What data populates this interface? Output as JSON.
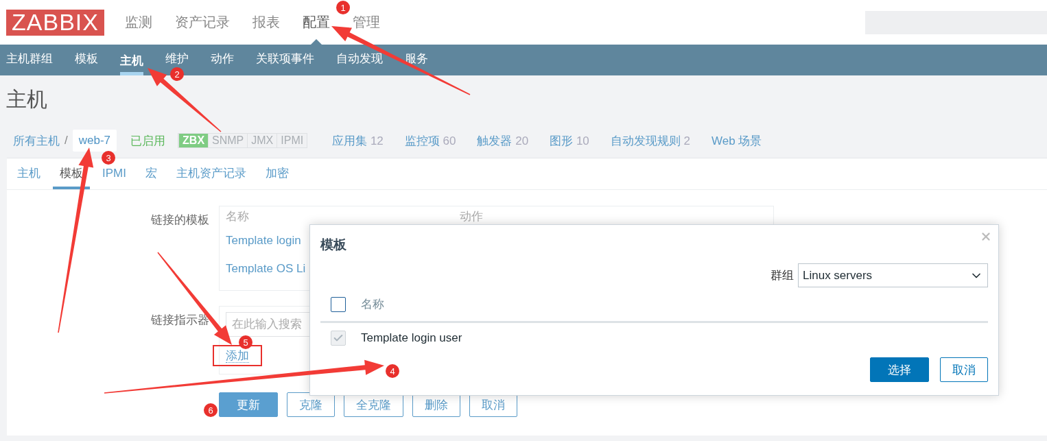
{
  "header": {
    "logo": "ZABBIX",
    "menu": [
      {
        "label": "监测",
        "selected": false
      },
      {
        "label": "资产记录",
        "selected": false
      },
      {
        "label": "报表",
        "selected": false
      },
      {
        "label": "配置",
        "selected": true
      },
      {
        "label": "管理",
        "selected": false
      }
    ]
  },
  "subnav": [
    {
      "label": "主机群组",
      "selected": false
    },
    {
      "label": "模板",
      "selected": false
    },
    {
      "label": "主机",
      "selected": true
    },
    {
      "label": "维护",
      "selected": false
    },
    {
      "label": "动作",
      "selected": false
    },
    {
      "label": "关联项事件",
      "selected": false
    },
    {
      "label": "自动发现",
      "selected": false
    },
    {
      "label": "服务",
      "selected": false
    }
  ],
  "page_title": "主机",
  "breadcrumb": {
    "root": "所有主机",
    "separator": "/",
    "current": "web-7"
  },
  "status": "已启用",
  "availability": [
    {
      "label": "ZBX",
      "on": true
    },
    {
      "label": "SNMP",
      "on": false
    },
    {
      "label": "JMX",
      "on": false
    },
    {
      "label": "IPMI",
      "on": false
    }
  ],
  "host_links": [
    {
      "label": "应用集",
      "count": "12"
    },
    {
      "label": "监控项",
      "count": "60"
    },
    {
      "label": "触发器",
      "count": "20"
    },
    {
      "label": "图形",
      "count": "10"
    },
    {
      "label": "自动发现规则",
      "count": "2"
    },
    {
      "label": "Web 场景"
    }
  ],
  "tabs": [
    {
      "label": "主机",
      "selected": false
    },
    {
      "label": "模板",
      "selected": true
    },
    {
      "label": "IPMI",
      "selected": false
    },
    {
      "label": "宏",
      "selected": false
    },
    {
      "label": "主机资产记录",
      "selected": false
    },
    {
      "label": "加密",
      "selected": false
    }
  ],
  "form": {
    "linked_templates": {
      "label": "链接的模板",
      "columns": [
        "名称",
        "动作"
      ],
      "rows": [
        "Template login",
        "Template OS Li"
      ]
    },
    "link_new": {
      "label": "链接指示器",
      "placeholder": "在此输入搜索",
      "add_link": "添加",
      "highlighted": true
    }
  },
  "buttons": [
    {
      "label": "更新",
      "kind": "primary"
    },
    {
      "label": "克隆",
      "kind": "secondary"
    },
    {
      "label": "全克隆",
      "kind": "secondary"
    },
    {
      "label": "删除",
      "kind": "secondary"
    },
    {
      "label": "取消",
      "kind": "secondary"
    }
  ],
  "dialog": {
    "title": "模板",
    "group_label": "群组",
    "group_value": "Linux servers",
    "column": "名称",
    "select_all_checked": false,
    "rows": [
      {
        "name": "Template login user",
        "checked": true,
        "disabled": true
      }
    ],
    "buttons": [
      {
        "label": "选择",
        "kind": "primary"
      },
      {
        "label": "取消",
        "kind": "secondary"
      }
    ]
  },
  "annotations": [
    {
      "number": "1",
      "kind": "arrow"
    },
    {
      "number": "2",
      "kind": "arrow"
    },
    {
      "number": "3",
      "kind": "arrow"
    },
    {
      "number": "4",
      "kind": "arrow"
    },
    {
      "number": "5",
      "kind": "arrow"
    },
    {
      "number": "6",
      "kind": "marker"
    }
  ]
}
